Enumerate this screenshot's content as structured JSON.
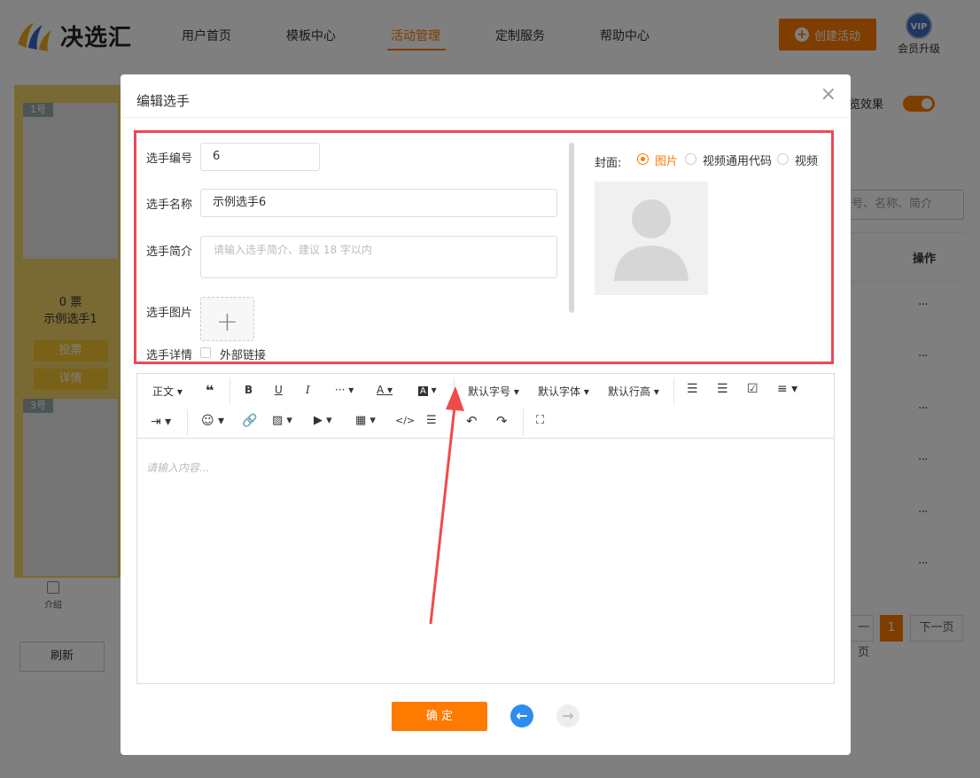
{
  "header": {
    "brand": "决选汇",
    "nav": [
      {
        "label": "用户首页"
      },
      {
        "label": "模板中心"
      },
      {
        "label": "活动管理"
      },
      {
        "label": "定制服务"
      },
      {
        "label": "帮助中心"
      }
    ],
    "create_button": "创建活动",
    "vip_badge": "VIP",
    "vip_label": "会员升级"
  },
  "background": {
    "cards": [
      {
        "number": "1号",
        "votes": "0 票",
        "name": "示例选手1",
        "vote_btn": "投票",
        "detail_btn": "详情"
      },
      {
        "number": "3号"
      }
    ],
    "intro_tab": "介绍",
    "refresh_button": "刷新",
    "preview_label": "览效果",
    "search_placeholder": "号、名称、简介",
    "column_op": "操作",
    "row_action": "···",
    "pager": {
      "prev": "一页",
      "current": "1",
      "next": "下一页"
    }
  },
  "modal": {
    "title": "编辑选手",
    "close": "×",
    "fields": {
      "number_label": "选手编号",
      "number_value": "6",
      "name_label": "选手名称",
      "name_value": "示例选手6",
      "intro_label": "选手简介",
      "intro_placeholder": "请输入选手简介、建议 18 字以内",
      "image_label": "选手图片",
      "upload_plus": "+",
      "detail_label": "选手详情",
      "external_link_label": "外部链接"
    },
    "cover": {
      "label": "封面:",
      "options": [
        {
          "label": "图片",
          "selected": true
        },
        {
          "label": "视频通用代码",
          "selected": false
        },
        {
          "label": "视频",
          "selected": false
        }
      ]
    },
    "editor": {
      "toolbar_row1": [
        "正文",
        "默认字号",
        "默认字体",
        "默认行高"
      ],
      "placeholder": "请输入内容..."
    },
    "confirm_button": "确 定"
  },
  "colors": {
    "brand_orange": "#ff7a00",
    "highlight_red": "#e94a55",
    "prev_nav_blue": "#2d8cf0"
  }
}
